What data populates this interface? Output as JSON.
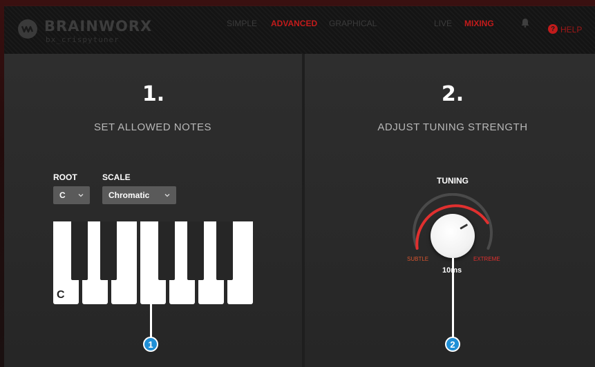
{
  "header": {
    "brand": "BRAINWORX",
    "product": "bx_crispytuner",
    "modes": [
      {
        "label": "SIMPLE",
        "active": false
      },
      {
        "label": "ADVANCED",
        "active": true
      },
      {
        "label": "GRAPHICAL",
        "active": false
      }
    ],
    "views": [
      {
        "label": "LIVE",
        "active": false
      },
      {
        "label": "MIXING",
        "active": true
      }
    ],
    "help_label": "HELP",
    "help_icon_glyph": "?",
    "accent_color": "#c21b1b"
  },
  "step1": {
    "number": "1.",
    "title": "SET ALLOWED NOTES",
    "root_label": "ROOT",
    "root_value": "C",
    "scale_label": "SCALE",
    "scale_value": "Chromatic",
    "piano_key_label": "C",
    "callout": "1"
  },
  "step2": {
    "number": "2.",
    "title": "ADJUST TUNING STRENGTH",
    "knob_title": "TUNING",
    "min_label": "SUBTLE",
    "max_label": "EXTREME",
    "value": "10ms",
    "callout": "2"
  }
}
